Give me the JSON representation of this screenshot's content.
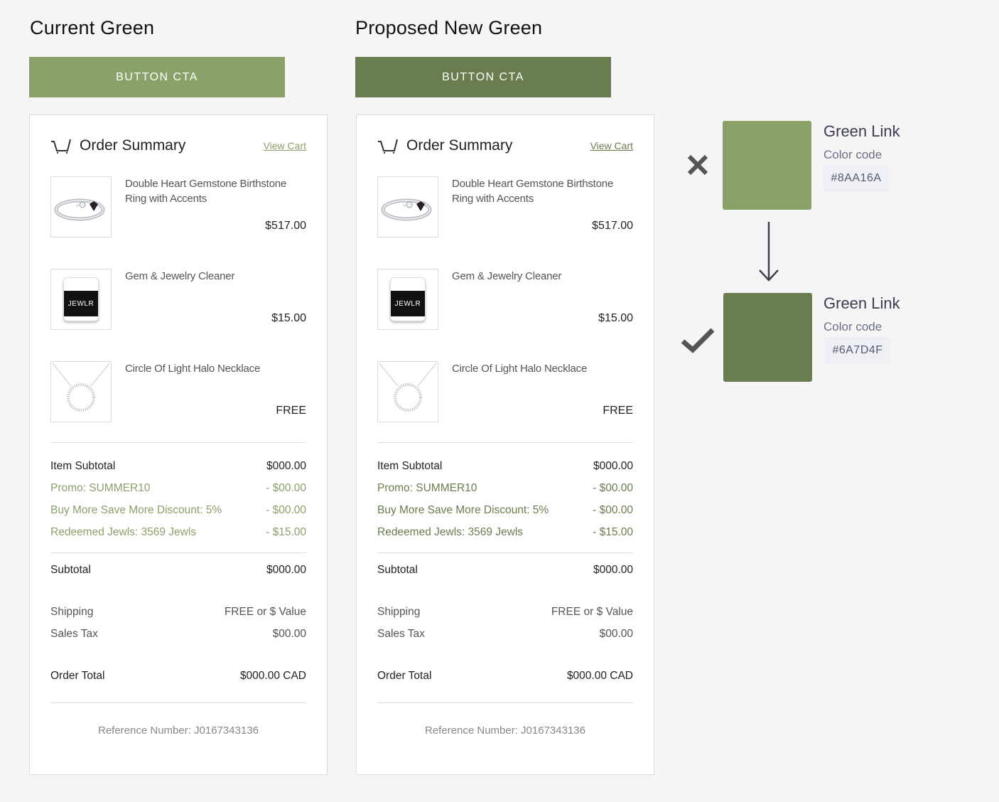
{
  "current": {
    "heading": "Current Green",
    "color": "#8AA16A",
    "cta_label": "BUTTON CTA"
  },
  "proposed": {
    "heading": "Proposed New Green",
    "color": "#6A7D4F",
    "cta_label": "BUTTON CTA"
  },
  "order_summary": {
    "title": "Order Summary",
    "view_cart": "View Cart",
    "icons": {
      "cart": "cart-icon"
    },
    "products": [
      {
        "name": "Double Heart Gemstone Birthstone Ring with Accents",
        "price": "$517.00",
        "icon": "ring-image"
      },
      {
        "name": "Gem & Jewelry Cleaner",
        "price": "$15.00",
        "icon": "cleaner-jar-image",
        "jar_label": "JEWLR"
      },
      {
        "name": "Circle Of Light Halo Necklace",
        "price": "FREE",
        "icon": "necklace-image"
      }
    ],
    "item_subtotal": {
      "label": "Item Subtotal",
      "value": "$000.00"
    },
    "discounts": [
      {
        "label": "Promo: SUMMER10",
        "value": "- $00.00"
      },
      {
        "label": "Buy More Save More Discount: 5%",
        "value": "- $00.00"
      },
      {
        "label": "Redeemed Jewls: 3569 Jewls",
        "value": "- $15.00"
      }
    ],
    "subtotal": {
      "label": "Subtotal",
      "value": "$000.00"
    },
    "shipping": {
      "label": "Shipping",
      "value": "FREE or $ Value"
    },
    "sales_tax": {
      "label": "Sales Tax",
      "value": "$00.00"
    },
    "order_total": {
      "label": "Order Total",
      "value": "$000.00 CAD"
    },
    "reference": "Reference Number: J0167343136"
  },
  "swatches": [
    {
      "title": "Green Link",
      "label": "Color code",
      "code": "#8AA16A",
      "color": "#8AA16A",
      "status": "rejected",
      "status_icon": "x-icon"
    },
    {
      "title": "Green Link",
      "label": "Color code",
      "code": "#6A7D4F",
      "color": "#6A7D4F",
      "status": "approved",
      "status_icon": "check-icon"
    }
  ],
  "arrow_icon": "arrow-down-icon"
}
